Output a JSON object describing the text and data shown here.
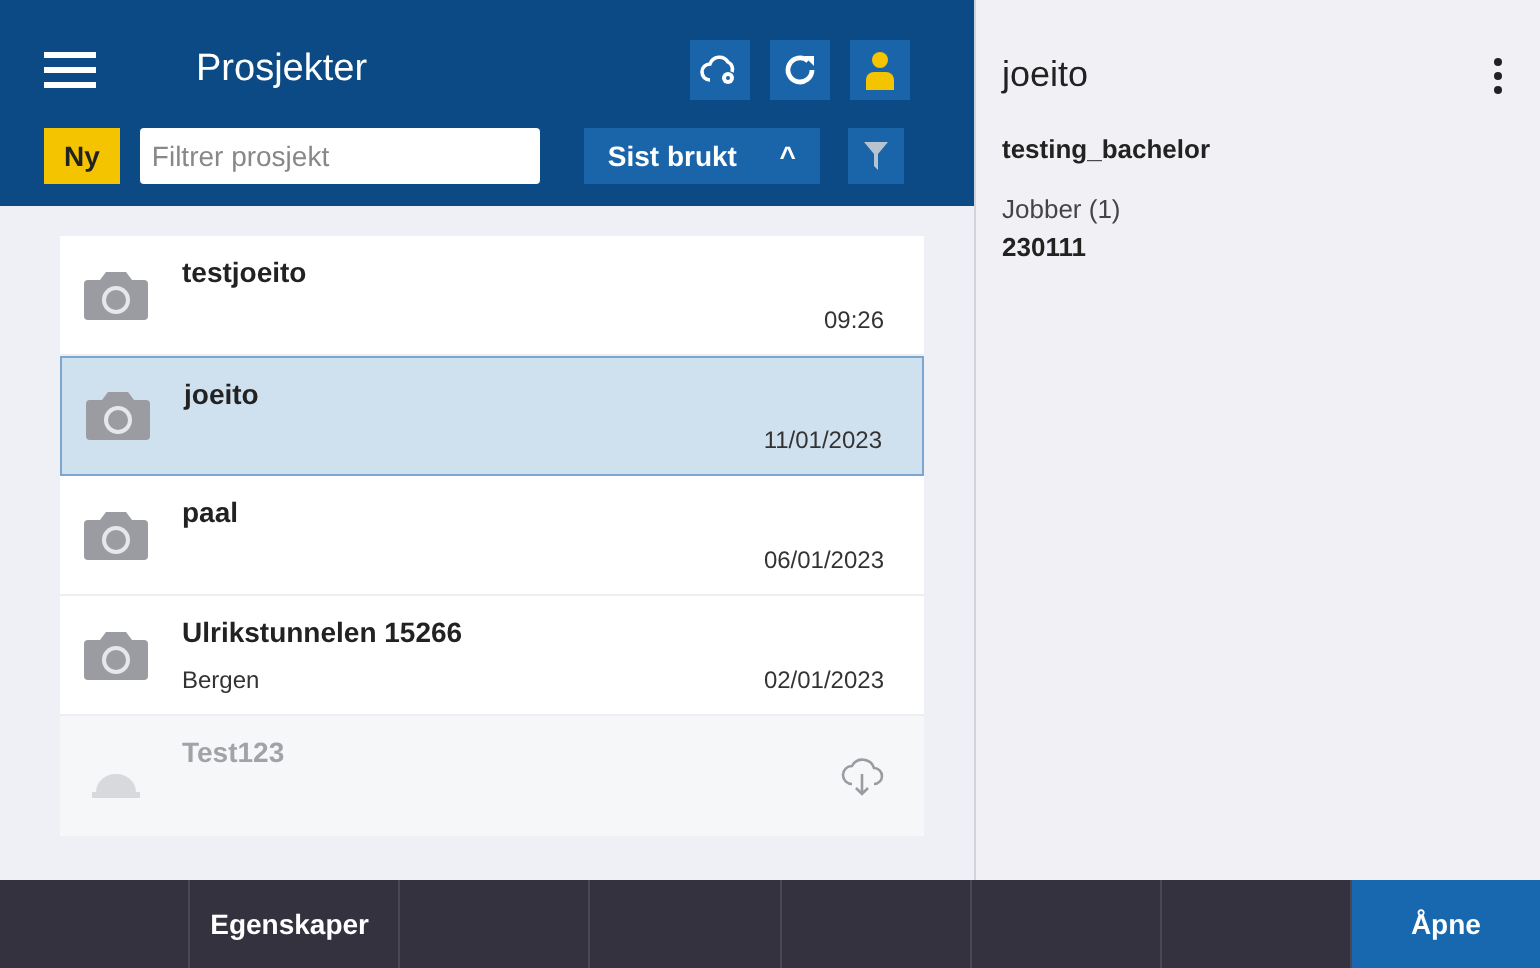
{
  "header": {
    "title": "Prosjekter",
    "new_button": "Ny",
    "filter": {
      "placeholder": "Filtrer prosjekt"
    },
    "sort": {
      "label": "Sist brukt",
      "caret": "^"
    }
  },
  "projects": [
    {
      "kind": "local",
      "name": "testjoeito",
      "date": "09:26",
      "selected": false
    },
    {
      "kind": "local",
      "name": "joeito",
      "date": "11/01/2023",
      "selected": true
    },
    {
      "kind": "local",
      "name": "paal",
      "date": "06/01/2023",
      "selected": false
    },
    {
      "kind": "local",
      "name": "Ulrikstunnelen 15266",
      "subtitle": "Bergen",
      "date": "02/01/2023",
      "selected": false
    },
    {
      "kind": "cloud",
      "name": "Test123",
      "selected": false
    }
  ],
  "details": {
    "title": "joeito",
    "owner": "testing_bachelor",
    "jobs_label": "Jobber (1)",
    "job": "230111"
  },
  "bottom_bar": [
    {
      "kind": "empty"
    },
    {
      "kind": "action",
      "label": "Egenskaper"
    },
    {
      "kind": "empty"
    },
    {
      "kind": "empty"
    },
    {
      "kind": "empty"
    },
    {
      "kind": "empty"
    },
    {
      "kind": "empty"
    },
    {
      "kind": "primary",
      "label": "Åpne"
    }
  ]
}
